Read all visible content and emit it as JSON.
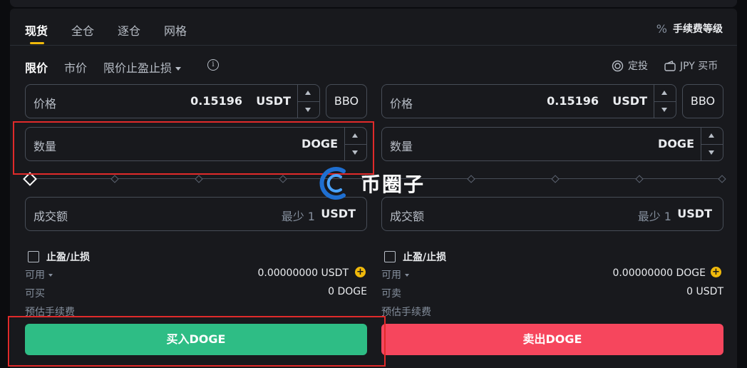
{
  "tabs": [
    {
      "label": "现货",
      "active": true
    },
    {
      "label": "全仓",
      "active": false
    },
    {
      "label": "逐仓",
      "active": false
    },
    {
      "label": "网格",
      "active": false
    }
  ],
  "fee_label": "手续费等级",
  "order_types": {
    "limit": "限价",
    "market": "市价",
    "stop": "限价止盈止损"
  },
  "right_links": {
    "auto_invest": "定投",
    "buy_currency": "JPY 买币"
  },
  "buy": {
    "price_label": "价格",
    "price_value": "0.15196",
    "price_unit": "USDT",
    "bbo_label": "BBO",
    "amount_label": "数量",
    "amount_unit": "DOGE",
    "total_label": "成交额",
    "total_hint": "最少 1",
    "total_unit": "USDT",
    "tpsl_label": "止盈/止损",
    "avail_label": "可用",
    "avail_value": "0.00000000 USDT",
    "max_label": "可买",
    "max_value": "0 DOGE",
    "fee_label": "预估手续费",
    "button_label": "买入DOGE"
  },
  "sell": {
    "price_label": "价格",
    "price_value": "0.15196",
    "price_unit": "USDT",
    "bbo_label": "BBO",
    "amount_label": "数量",
    "amount_unit": "DOGE",
    "total_label": "成交额",
    "total_hint": "最少 1",
    "total_unit": "USDT",
    "tpsl_label": "止盈/止损",
    "avail_label": "可用",
    "avail_value": "0.00000000 DOGE",
    "max_label": "可卖",
    "max_value": "0 USDT",
    "fee_label": "预估手续费",
    "button_label": "卖出DOGE"
  },
  "watermark_text": "币圈子",
  "colors": {
    "buy": "#2ebd85",
    "sell": "#f6465d",
    "accent": "#f0b90b",
    "highlight": "#e02a2a"
  }
}
